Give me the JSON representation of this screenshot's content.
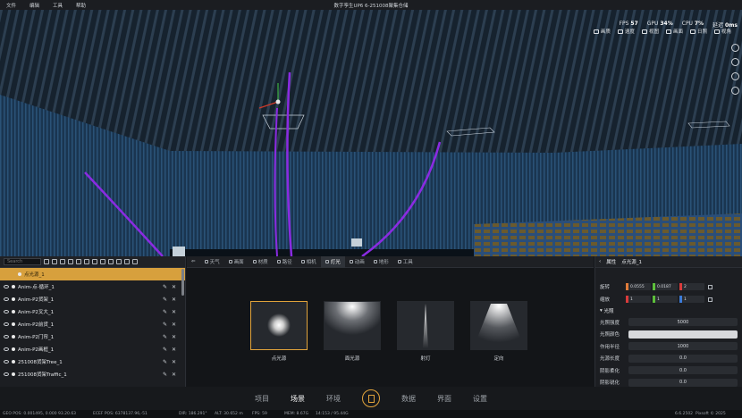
{
  "menu": {
    "items": [
      "文件",
      "编辑",
      "工具",
      "帮助"
    ],
    "window_title": "数字孪生UP6 6-251008聚集仓储"
  },
  "stats": [
    {
      "label": "FPS",
      "value": "57"
    },
    {
      "label": "GPU",
      "value": "34%"
    },
    {
      "label": "CPU",
      "value": "7%"
    },
    {
      "label": "延迟",
      "value": "0ms"
    }
  ],
  "view_buttons": [
    "画质",
    "速度",
    "视图",
    "画面",
    "日照",
    "视角"
  ],
  "left_panel": {
    "search_placeholder": "Search",
    "tree": [
      {
        "label": "点光源_1",
        "selected": true
      },
      {
        "label": "Anim-点-循环_1"
      },
      {
        "label": "Anim-P2货架_1"
      },
      {
        "label": "Anim-P2叉大_1"
      },
      {
        "label": "Anim-P2前货_1"
      },
      {
        "label": "Anim-P2门帘_1"
      },
      {
        "label": "Anim-P2画框_1"
      },
      {
        "label": "251008货架Tree_1"
      },
      {
        "label": "251008货架Traffic_1"
      }
    ]
  },
  "mid_panel": {
    "tabs": [
      {
        "label": "天气",
        "active": false
      },
      {
        "label": "画面",
        "active": false
      },
      {
        "label": "材质",
        "active": false
      },
      {
        "label": "路径",
        "active": false
      },
      {
        "label": "相机",
        "active": false
      },
      {
        "label": "灯光",
        "active": true
      },
      {
        "label": "动画",
        "active": false
      },
      {
        "label": "地形",
        "active": false
      },
      {
        "label": "工具",
        "active": false
      }
    ],
    "lights": [
      {
        "label": "点光源",
        "icon": "point-light-icon",
        "active": true
      },
      {
        "label": "面光源",
        "icon": "area-light-icon",
        "active": false
      },
      {
        "label": "射灯",
        "icon": "spot-light-icon",
        "active": false
      },
      {
        "label": "定向",
        "icon": "directional-light-icon",
        "active": false
      }
    ]
  },
  "right_panel": {
    "header_title": "属性",
    "header_object": "点光源_1",
    "rotation_label": "旋转",
    "rotation": [
      "0.0555",
      "0.0187",
      "2"
    ],
    "scale_label": "缩放",
    "scale": [
      "1",
      "1",
      "1"
    ],
    "section_title": "光照",
    "props": [
      {
        "label": "光照强度",
        "value": "5000"
      },
      {
        "label": "光照颜色",
        "value": ""
      },
      {
        "label": "作用半径",
        "value": "1000"
      },
      {
        "label": "光源长度",
        "value": "0.0"
      },
      {
        "label": "阴影柔化",
        "value": "0.0"
      },
      {
        "label": "阴影锐化",
        "value": "0.0"
      }
    ]
  },
  "bottom_nav": {
    "items": [
      "项目",
      "场景",
      "环境",
      "数据",
      "界面",
      "设置"
    ],
    "active": "场景"
  },
  "statusbar": {
    "geo": "GEO POS: 0.001495, 0.000 93.20.63",
    "ecef": "ECEF POS: 6378137.96,-51",
    "dir": "DIR: 186.291°",
    "alt": "ALT: 30.652 m",
    "fps": "FPS: 59",
    "mem": "MEM: 8.67G",
    "time": "14:153 / 95.44G",
    "version": "6.6.2502",
    "copyright": "Pixsoft © 2025"
  },
  "colors": {
    "accent": "#e1a33b",
    "selected_row": "#d7a03d",
    "path_curve": "#8a2be2",
    "wall": "#1f3f5e"
  }
}
